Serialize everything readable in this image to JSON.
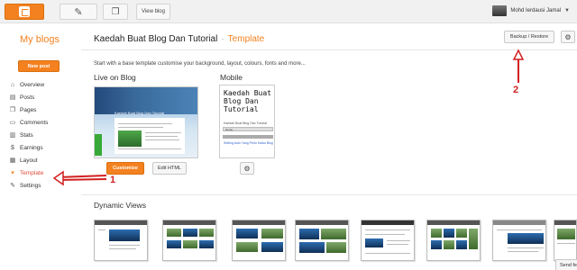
{
  "topbar": {
    "view_blog_label": "View blog",
    "user_name": "Mohd Ierdausi Jamal",
    "icons": [
      "blogger-icon",
      "pencil-icon",
      "pages-icon",
      "avatar",
      "chevron-down-icon"
    ]
  },
  "sidebar": {
    "heading": "My blogs",
    "new_post_label": "New post",
    "items": [
      {
        "label": "Overview",
        "icon": "home-icon"
      },
      {
        "label": "Posts",
        "icon": "posts-icon"
      },
      {
        "label": "Pages",
        "icon": "pages-icon"
      },
      {
        "label": "Comments",
        "icon": "comments-icon"
      },
      {
        "label": "Stats",
        "icon": "stats-icon"
      },
      {
        "label": "Earnings",
        "icon": "earnings-icon"
      },
      {
        "label": "Layout",
        "icon": "layout-icon"
      },
      {
        "label": "Template",
        "icon": "template-icon",
        "active": true
      },
      {
        "label": "Settings",
        "icon": "wrench-icon"
      }
    ]
  },
  "header": {
    "blog_title": "Kaedah Buat Blog Dan Tutorial",
    "separator": "·",
    "section": "Template",
    "backup_label": "Backup / Restore"
  },
  "main": {
    "intro": "Start with a base template customise your background, layout, colours, fonts and more...",
    "live": {
      "heading": "Live on Blog",
      "thumb_title": "Kaedah Buat Blog Dan Tutorial",
      "customize_label": "Customize",
      "edit_html_label": "Edit HTML"
    },
    "mobile": {
      "heading": "Mobile",
      "thumb_title": "Kaedah Buat Blog Dan Tutorial",
      "thumb_subtitle": "Kaedah Buat Blog Dan Tutorial",
      "thumb_nav": "Home",
      "thumb_date": "",
      "thumb_link": "Setting Auto Yang Perlu Kalau Blog"
    },
    "dynamic": {
      "heading": "Dynamic Views",
      "views_count": 8
    }
  },
  "feedback_label": "Send feed",
  "annotations": {
    "label_1": "1",
    "label_2": "2",
    "color": "#d21f1f"
  },
  "colors": {
    "accent": "#f4811f",
    "active_nav": "#dd4b39",
    "link": "#3366cc"
  }
}
